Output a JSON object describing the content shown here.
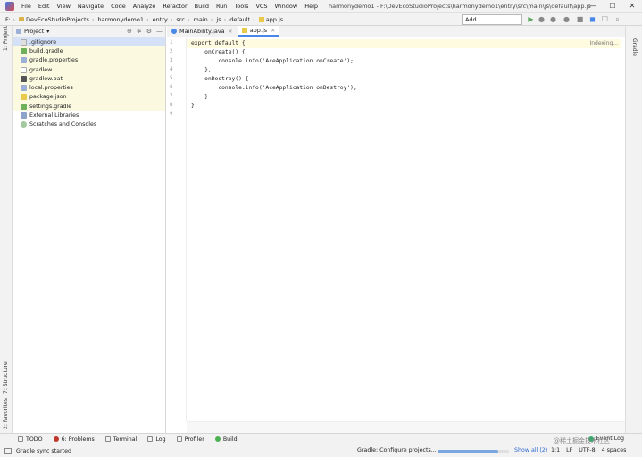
{
  "menubar": {
    "items": [
      "File",
      "Edit",
      "View",
      "Navigate",
      "Code",
      "Analyze",
      "Refactor",
      "Build",
      "Run",
      "Tools",
      "VCS",
      "Window",
      "Help"
    ],
    "title": "harmonydemo1 - F:\\DevEcoStudioProjects\\harmonydemo1\\entry\\src\\main\\js\\default\\app.js",
    "minimize": "—",
    "maximize": "☐",
    "close": "✕"
  },
  "navbar": {
    "crumbs": [
      "F:",
      "DevEcoStudioProjects",
      "harmonydemo1",
      "entry",
      "src",
      "main",
      "js",
      "default",
      "app.js"
    ],
    "run_config": "Add Configuration..."
  },
  "left_stripe": {
    "project": "1: Project",
    "structure": "7: Structure",
    "favorites": "2: Favorites"
  },
  "right_stripe": {
    "gradle": "Gradle"
  },
  "project_panel": {
    "title": "Project",
    "dropdown": "▾",
    "items": [
      {
        "label": ".gitignore",
        "icon": "gitignore"
      },
      {
        "label": "build.gradle",
        "icon": "gradle"
      },
      {
        "label": "gradle.properties",
        "icon": "props"
      },
      {
        "label": "gradlew",
        "icon": "file"
      },
      {
        "label": "gradlew.bat",
        "icon": "bat"
      },
      {
        "label": "local.properties",
        "icon": "props"
      },
      {
        "label": "package.json",
        "icon": "json"
      },
      {
        "label": "settings.gradle",
        "icon": "gradle"
      },
      {
        "label": "External Libraries",
        "icon": "lib"
      },
      {
        "label": "Scratches and Consoles",
        "icon": "scratch"
      }
    ]
  },
  "editor": {
    "tabs": [
      {
        "label": "MainAbility.java",
        "active": false
      },
      {
        "label": "app.js",
        "active": true
      }
    ],
    "line_numbers": [
      "1",
      "2",
      "3",
      "4",
      "5",
      "6",
      "7",
      "8",
      "9"
    ],
    "code_lines": [
      "export default {",
      "    onCreate() {",
      "        console.info('AceApplication onCreate');",
      "    },",
      "    onDestroy() {",
      "        console.info('AceApplication onDestroy');",
      "    }",
      "};",
      ""
    ],
    "indexing": "Indexing..."
  },
  "toolwindows": {
    "items": [
      "TODO",
      "6: Problems",
      "Terminal",
      "Log",
      "Profiler",
      "Build"
    ],
    "event_log": "Event Log"
  },
  "statusbar": {
    "message": "Gradle sync started",
    "task": "Gradle: Configure projects...",
    "progress": 0.85,
    "show_all": "Show all (2)",
    "position": "1:1",
    "line_sep": "LF",
    "encoding": "UTF-8",
    "indent": "4 spaces",
    "watermark": "@稀土掘金技术社区"
  }
}
